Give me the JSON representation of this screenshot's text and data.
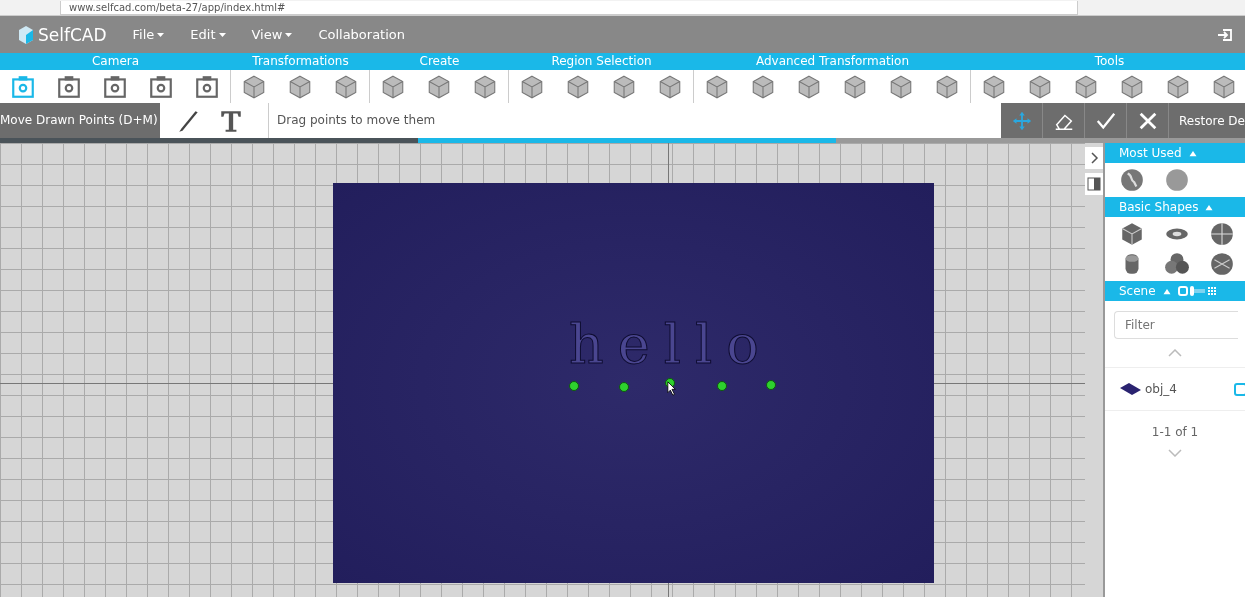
{
  "browser": {
    "url": "www.selfcad.com/beta-27/app/index.html#"
  },
  "menu": {
    "logo": "SelfCAD",
    "items": [
      {
        "label": "File",
        "dropdown": true
      },
      {
        "label": "Edit",
        "dropdown": true
      },
      {
        "label": "View",
        "dropdown": true
      },
      {
        "label": "Collaboration",
        "dropdown": false
      }
    ]
  },
  "toolbar": [
    {
      "label": "Camera",
      "kind": "frame",
      "tools": [
        {
          "selected": true
        },
        {
          "selected": false
        },
        {
          "selected": false
        },
        {
          "selected": false
        },
        {
          "selected": false
        }
      ]
    },
    {
      "label": "Transformations",
      "kind": "cube",
      "tools": [
        {
          "selected": false
        },
        {
          "selected": false
        },
        {
          "selected": false
        }
      ]
    },
    {
      "label": "Create",
      "kind": "cube",
      "tools": [
        {
          "selected": false
        },
        {
          "selected": false
        },
        {
          "selected": false
        }
      ]
    },
    {
      "label": "Region Selection",
      "kind": "cube",
      "tools": [
        {
          "selected": false
        },
        {
          "selected": false
        },
        {
          "selected": false
        },
        {
          "selected": false
        }
      ]
    },
    {
      "label": "Advanced Transformation",
      "kind": "cube",
      "tools": [
        {
          "selected": false
        },
        {
          "selected": false
        },
        {
          "selected": false
        },
        {
          "selected": false
        },
        {
          "selected": false
        },
        {
          "selected": false
        }
      ]
    },
    {
      "label": "Tools",
      "kind": "cube",
      "tools": [
        {
          "selected": false
        },
        {
          "selected": false
        },
        {
          "selected": false
        },
        {
          "selected": false
        },
        {
          "selected": false
        },
        {
          "selected": false
        }
      ]
    }
  ],
  "tool_bar": {
    "mode": "Move Drawn Points (D+M)",
    "hint": "Drag points to move them",
    "actions": [
      {
        "kind": "move",
        "selected": true
      },
      {
        "kind": "eraser",
        "selected": false
      },
      {
        "kind": "check",
        "selected": false
      },
      {
        "kind": "close",
        "selected": false
      }
    ],
    "restore": "Restore De",
    "progress": {
      "level": 0.506
    }
  },
  "viewport": {
    "model_text": "hello"
  },
  "panel": {
    "most_used": {
      "title": "Most Used",
      "expanded": true
    },
    "basic_shapes": {
      "title": "Basic Shapes",
      "expanded": true
    },
    "scene": {
      "title": "Scene",
      "expanded": true,
      "grid_view": false,
      "filter_placeholder": "Filter",
      "objects": [
        {
          "name": "obj_4",
          "color": "#2a2370"
        }
      ],
      "pager": "1-1 of 1"
    }
  }
}
